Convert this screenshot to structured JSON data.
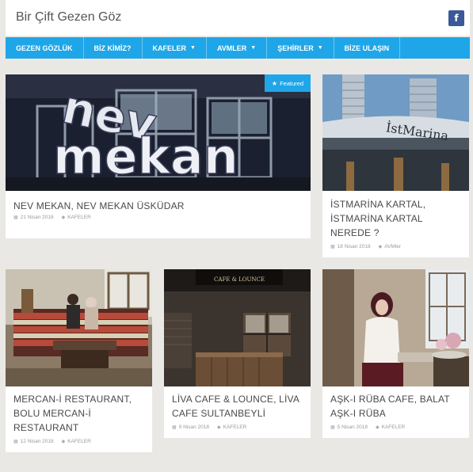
{
  "site": {
    "title": "Bir Çift Gezen Göz",
    "facebook_icon": "facebook-icon"
  },
  "nav": {
    "items": [
      {
        "label": "GEZEN GÖZLÜK",
        "dropdown": false
      },
      {
        "label": "BİZ KİMİZ?",
        "dropdown": false
      },
      {
        "label": "KAFELER",
        "dropdown": true
      },
      {
        "label": "AVMLER",
        "dropdown": true
      },
      {
        "label": "ŞEHİRLER",
        "dropdown": true
      },
      {
        "label": "BİZE ULAŞIN",
        "dropdown": false
      }
    ]
  },
  "featured_label": "Featured",
  "posts": [
    {
      "title": "NEV MEKAN, NEV MEKAN ÜSKÜDAR",
      "date": "21 Nisan 2018",
      "category": "KAFELER",
      "featured": true
    },
    {
      "title": "İSTMARİNA KARTAL, İSTMARİNA KARTAL NEREDE ?",
      "date": "18 Nisan 2018",
      "category": "AVMler",
      "featured": false
    },
    {
      "title": "MERCAN-İ RESTAURANT, BOLU MERCAN-İ RESTAURANT",
      "date": "12 Nisan 2018",
      "category": "KAFELER",
      "featured": false
    },
    {
      "title": "LİVA CAFE & LOUNCE, LİVA CAFE SULTANBEYLİ",
      "date": "9 Nisan 2018",
      "category": "KAFELER",
      "featured": false
    },
    {
      "title": "AŞK-I RÜBA CAFE, BALAT AŞK-I RÜBA",
      "date": "5 Nisan 2018",
      "category": "KAFELER",
      "featured": false
    }
  ],
  "image_text": {
    "nevmekan_sign": "nev mekan",
    "istmarina_sign": "İstMarina",
    "liva_sign": "CAFE & LOUNCE"
  }
}
